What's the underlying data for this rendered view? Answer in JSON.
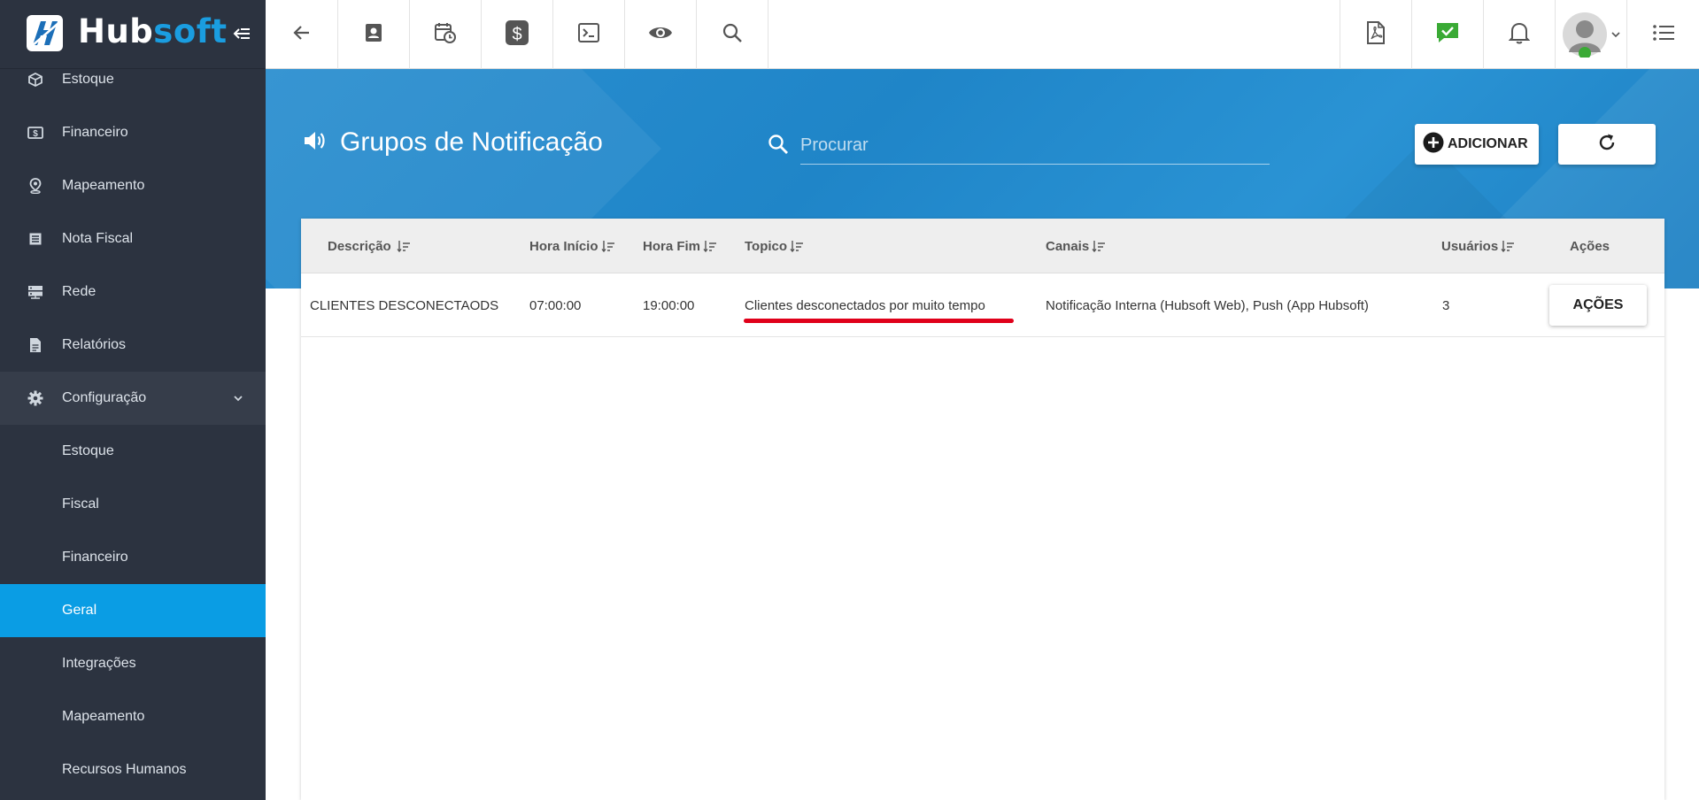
{
  "brand": {
    "name_part1": "Hub",
    "name_part2": "soft"
  },
  "sidebar": {
    "items": [
      {
        "label": "Estoque",
        "icon": "box-icon"
      },
      {
        "label": "Financeiro",
        "icon": "money-icon"
      },
      {
        "label": "Mapeamento",
        "icon": "map-pin-icon"
      },
      {
        "label": "Nota Fiscal",
        "icon": "invoice-icon"
      },
      {
        "label": "Rede",
        "icon": "server-icon"
      },
      {
        "label": "Relatórios",
        "icon": "report-icon"
      },
      {
        "label": "Configuração",
        "icon": "gear-icon"
      }
    ],
    "sub_items": [
      {
        "label": "Estoque"
      },
      {
        "label": "Fiscal"
      },
      {
        "label": "Financeiro"
      },
      {
        "label": "Geral",
        "active": true
      },
      {
        "label": "Integrações"
      },
      {
        "label": "Mapeamento"
      },
      {
        "label": "Recursos Humanos"
      }
    ]
  },
  "topbar": {
    "left_icons": [
      "back-arrow-icon",
      "contact-card-icon",
      "calendar-clock-icon",
      "dollar-icon",
      "terminal-icon",
      "eye-icon",
      "search-icon"
    ],
    "right_icons": [
      "pdf-icon",
      "chat-check-icon",
      "bell-icon",
      "user-avatar",
      "menu-list-icon"
    ]
  },
  "page": {
    "title": "Grupos de Notificação",
    "search_placeholder": "Procurar",
    "add_label": "ADICIONAR"
  },
  "table": {
    "columns": [
      "Descrição",
      "Hora Início",
      "Hora Fim",
      "Topico",
      "Canais",
      "Usuários",
      "Ações"
    ],
    "rows": [
      {
        "descricao": "CLIENTES DESCONECTAODS",
        "hora_inicio": "07:00:00",
        "hora_fim": "19:00:00",
        "topico": "Clientes desconectados por muito tempo",
        "canais": "Notificação Interna (Hubsoft Web), Push (App Hubsoft)",
        "usuarios": "3",
        "acoes_label": "AÇÕES"
      }
    ]
  },
  "colors": {
    "sidebar_bg": "#2c3340",
    "sidebar_active": "#0a9de4",
    "banner": "#2389cb",
    "brand_accent": "#1a9de0",
    "highlight_underline": "#e0001a",
    "chat_icon_green": "#3aaa35"
  }
}
